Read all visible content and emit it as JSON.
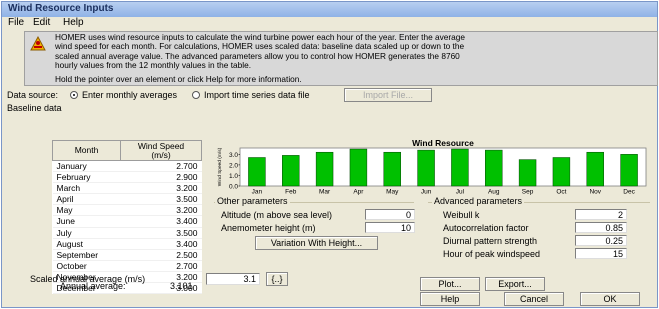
{
  "window": {
    "title": "Wind Resource Inputs"
  },
  "menu": {
    "file": "File",
    "edit": "Edit",
    "help": "Help"
  },
  "info": {
    "icon": "homer-wind-icon",
    "line1": "HOMER uses wind resource inputs to calculate the wind turbine power each hour of the year. Enter the average",
    "line2": "wind speed for each month. For calculations, HOMER uses scaled data: baseline data scaled up or down to the",
    "line3": "scaled annual average value. The advanced parameters allow you to control how HOMER generates the 8760",
    "line4": "hourly values from the 12 monthly values in the table.",
    "hold": "Hold the pointer over an element or click Help for more information."
  },
  "data_source": {
    "label": "Data source:",
    "option_monthly": "Enter monthly averages",
    "option_import": "Import time series data file",
    "selected": "monthly",
    "import_button": "Import File..."
  },
  "baseline": {
    "label": "Baseline data",
    "col_month": "Month",
    "col_speed_1": "Wind Speed",
    "col_speed_2": "(m/s)",
    "rows": [
      {
        "month": "January",
        "value": "2.700"
      },
      {
        "month": "February",
        "value": "2.900"
      },
      {
        "month": "March",
        "value": "3.200"
      },
      {
        "month": "April",
        "value": "3.500"
      },
      {
        "month": "May",
        "value": "3.200"
      },
      {
        "month": "June",
        "value": "3.400"
      },
      {
        "month": "July",
        "value": "3.500"
      },
      {
        "month": "August",
        "value": "3.400"
      },
      {
        "month": "September",
        "value": "2.500"
      },
      {
        "month": "October",
        "value": "2.700"
      },
      {
        "month": "November",
        "value": "3.200"
      },
      {
        "month": "December",
        "value": "3.000"
      }
    ],
    "annual_label": "Annual average:",
    "annual_value": "3.101"
  },
  "chart_data": {
    "type": "bar",
    "title": "Wind Resource",
    "ylabel": "Wind Speed (m/s)",
    "categories": [
      "Jan",
      "Feb",
      "Mar",
      "Apr",
      "May",
      "Jun",
      "Jul",
      "Aug",
      "Sep",
      "Oct",
      "Nov",
      "Dec"
    ],
    "values": [
      2.7,
      2.9,
      3.2,
      3.5,
      3.2,
      3.4,
      3.5,
      3.4,
      2.5,
      2.7,
      3.2,
      3.0
    ],
    "yticks": [
      "0.0",
      "1.0",
      "2.0",
      "3.0"
    ],
    "ylim": [
      0,
      3.6
    ],
    "bar_color": "#00c000",
    "bg_color": "#ffffff"
  },
  "other": {
    "label": "Other parameters",
    "altitude_label": "Altitude (m above sea level)",
    "altitude_value": "0",
    "anemometer_label": "Anemometer height (m)",
    "anemometer_value": "10",
    "variation_button": "Variation With Height..."
  },
  "advanced": {
    "label": "Advanced parameters",
    "weibull_label": "Weibull k",
    "weibull_value": "2",
    "autocorr_label": "Autocorrelation factor",
    "autocorr_value": "0.85",
    "diurnal_label": "Diurnal pattern strength",
    "diurnal_value": "0.25",
    "peak_label": "Hour of peak windspeed",
    "peak_value": "15"
  },
  "scaled": {
    "label": "Scaled annual average (m/s)",
    "value": "3.1",
    "button": "{..}"
  },
  "buttons": {
    "plot": "Plot...",
    "export": "Export...",
    "help": "Help",
    "cancel": "Cancel",
    "ok": "OK"
  }
}
